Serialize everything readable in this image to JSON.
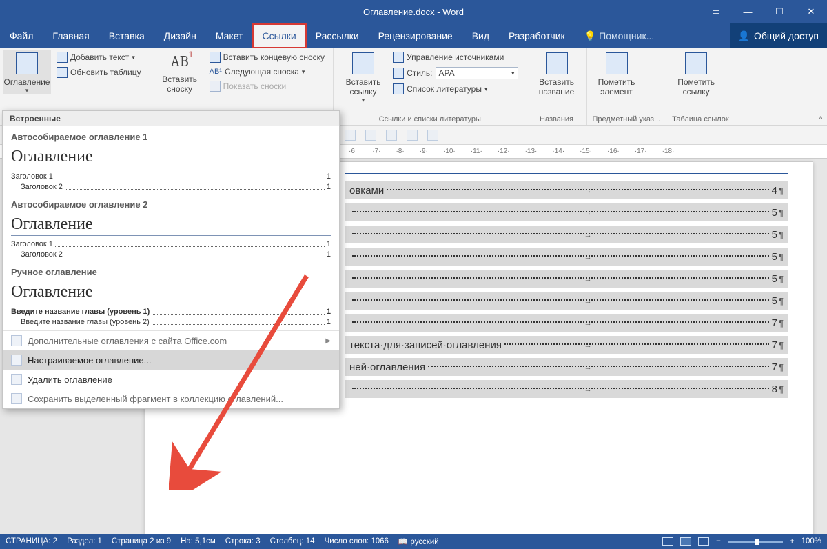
{
  "title": "Оглавление.docx - Word",
  "menu": [
    "Файл",
    "Главная",
    "Вставка",
    "Дизайн",
    "Макет",
    "Ссылки",
    "Рассылки",
    "Рецензирование",
    "Вид",
    "Разработчик"
  ],
  "active_menu_index": 5,
  "tell_me": "Помощник...",
  "share": "Общий доступ",
  "ribbon": {
    "toc_btn": "Оглавление",
    "add_text": "Добавить текст",
    "update_table": "Обновить таблицу",
    "insert_footnote": "Вставить сноску",
    "insert_endnote": "Вставить концевую сноску",
    "next_footnote": "Следующая сноска",
    "show_notes": "Показать сноски",
    "insert_citation": "Вставить ссылку",
    "manage_sources": "Управление источниками",
    "style_label": "Стиль:",
    "style_value": "APA",
    "bibliography": "Список литературы",
    "insert_caption": "Вставить название",
    "mark_entry": "Пометить элемент",
    "mark_citation": "Пометить ссылку",
    "grp_citations": "Ссылки и списки литературы",
    "grp_captions": "Названия",
    "grp_index": "Предметный указ...",
    "grp_toa": "Таблица ссылок"
  },
  "dropdown": {
    "header": "Встроенные",
    "sec1_title": "Автособираемое оглавление 1",
    "sec2_title": "Автособираемое оглавление 2",
    "sec3_title": "Ручное оглавление",
    "toc_heading": "Оглавление",
    "h1": "Заголовок 1",
    "h2": "Заголовок 2",
    "manual_l1": "Введите название главы (уровень 1)",
    "manual_l2": "Введите название главы (уровень 2)",
    "pnum": "1",
    "more_office": "Дополнительные оглавления с сайта Office.com",
    "custom_toc": "Настраиваемое оглавление...",
    "remove_toc": "Удалить оглавление",
    "save_selection": "Сохранить выделенный фрагмент в коллекцию оглавлений..."
  },
  "ruler_marks": [
    "·6·",
    "·7·",
    "·8·",
    "·9·",
    "·10·",
    "·11·",
    "·12·",
    "·13·",
    "·14·",
    "·15·",
    "·16·",
    "·17·",
    "·18·"
  ],
  "doc_rows": [
    {
      "t": "овками",
      "p": "4"
    },
    {
      "t": "",
      "p": "5"
    },
    {
      "t": "",
      "p": "5"
    },
    {
      "t": "",
      "p": "5"
    },
    {
      "t": "",
      "p": "5"
    },
    {
      "t": "",
      "p": "5"
    },
    {
      "t": "",
      "p": "7"
    },
    {
      "t": "текста·для·записей·оглавления",
      "p": "7"
    },
    {
      "t": "ней·оглавления",
      "p": "7"
    },
    {
      "t": "",
      "p": "8"
    }
  ],
  "status": {
    "page": "СТРАНИЦА: 2",
    "section": "Раздел: 1",
    "pages": "Страница 2 из 9",
    "at": "На: 5,1см",
    "line": "Строка: 3",
    "col": "Столбец: 14",
    "words": "Число слов: 1066",
    "lang": "русский",
    "zoom": "100%"
  }
}
